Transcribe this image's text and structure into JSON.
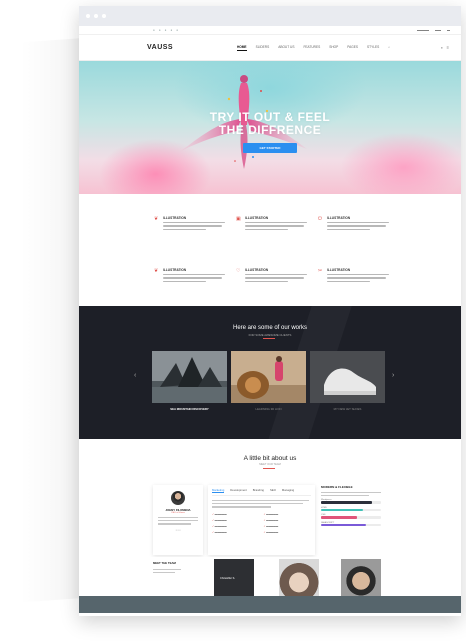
{
  "site": {
    "logo": "VAUSS",
    "nav": [
      "HOME",
      "SLIDERS",
      "ABOUT US",
      "FEATURES",
      "SHOP",
      "PAGES",
      "STYLES"
    ]
  },
  "hero": {
    "title_line1": "TRY IT OUT & FEEL",
    "title_line2": "THE DIFFRENCE",
    "button": "GET STARTED"
  },
  "features": [
    {
      "icon": "leaf-icon",
      "title": "ILLUSTRATION"
    },
    {
      "icon": "box-icon",
      "title": "ILLUSTRATION"
    },
    {
      "icon": "power-icon",
      "title": "ILLUSTRATION"
    },
    {
      "icon": "leaf-icon",
      "title": "ILLUSTRATION"
    },
    {
      "icon": "heart-icon",
      "title": "ILLUSTRATION"
    },
    {
      "icon": "scissors-icon",
      "title": "ILLUSTRATION"
    }
  ],
  "works": {
    "title": "Here are some of our works",
    "subtitle": "FOR SOME AWESOME CLIENTS",
    "items": [
      "SEA MOUNTAIN DISCOVERY",
      "LEARNING 3D LION",
      "MY NEW JET SHOES"
    ]
  },
  "about": {
    "title": "A little bit about us",
    "subtitle": "MEET OUR TEAM",
    "profile_name": "JOHNY FILOMENA",
    "profile_role": "CEO of Vauss",
    "tabs": [
      "Marketing",
      "Development",
      "Branding",
      "SEO",
      "Managing"
    ],
    "active_tab": "Marketing",
    "skills_title": "MODERN & FLEXIBLE",
    "skills": [
      {
        "label": "Wordpress",
        "value": 85,
        "color": "#2b2f3a"
      },
      {
        "label": "HTML",
        "value": 70,
        "color": "#3fc2b6"
      },
      {
        "label": "CSS",
        "value": 60,
        "color": "#e0557a"
      },
      {
        "label": "JAVASCRIPT",
        "value": 75,
        "color": "#7a5ad8"
      }
    ]
  },
  "team": {
    "label": "MEET THE TEAM",
    "member": "Christoffer S."
  }
}
